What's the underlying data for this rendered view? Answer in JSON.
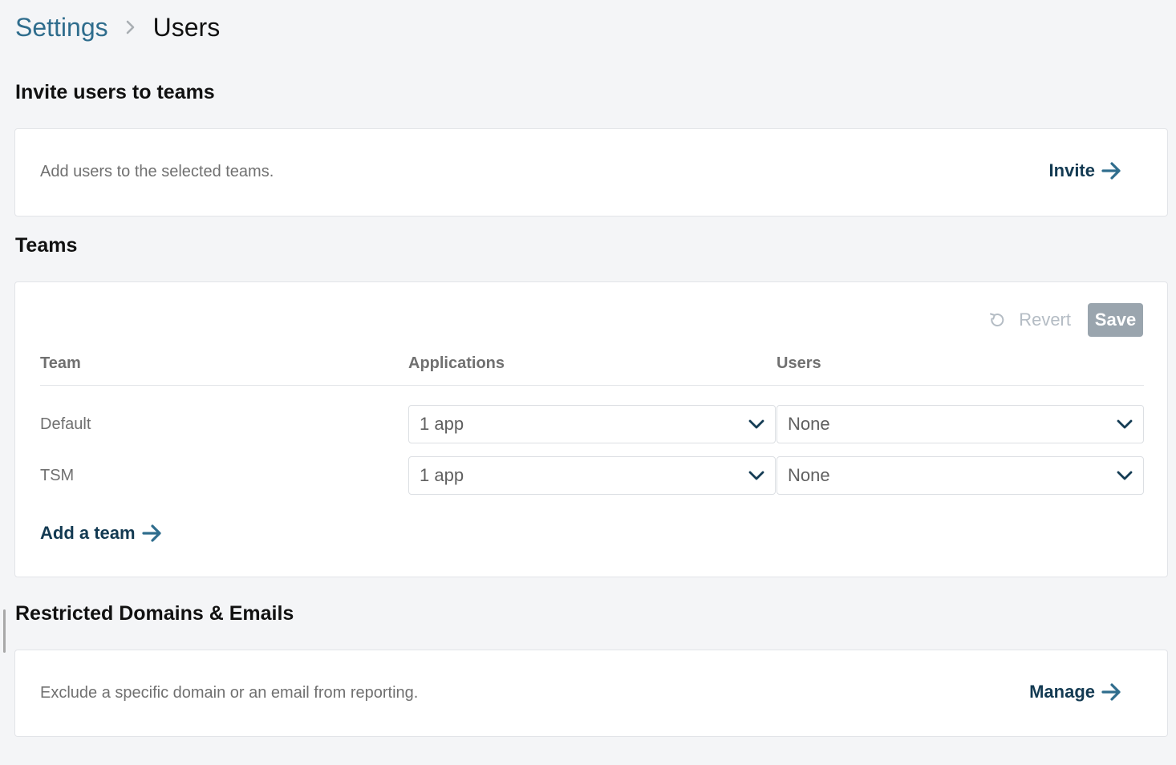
{
  "breadcrumb": {
    "parent": "Settings",
    "current": "Users"
  },
  "invite_section": {
    "title": "Invite users to teams",
    "description": "Add users to the selected teams.",
    "action_label": "Invite"
  },
  "teams_section": {
    "title": "Teams",
    "revert_label": "Revert",
    "save_label": "Save",
    "columns": [
      "Team",
      "Applications",
      "Users"
    ],
    "rows": [
      {
        "team": "Default",
        "applications": "1 app",
        "users": "None"
      },
      {
        "team": "TSM",
        "applications": "1 app",
        "users": "None"
      }
    ],
    "add_team_label": "Add a team"
  },
  "restricted_section": {
    "title": "Restricted Domains & Emails",
    "description": "Exclude a specific domain or an email from reporting.",
    "action_label": "Manage"
  },
  "icons": {
    "breadcrumb_separator": "chevron-right-icon",
    "link_arrow": "arrow-right-icon",
    "revert": "revert-icon",
    "dropdown": "chevron-down-icon"
  },
  "colors": {
    "background": "#f4f5f7",
    "breadcrumb_link": "#2f6d8d",
    "action_link": "#133a52",
    "arrow": "#2f6d8d",
    "disabled_button": "#9aa5ae",
    "muted_text": "#707070"
  }
}
